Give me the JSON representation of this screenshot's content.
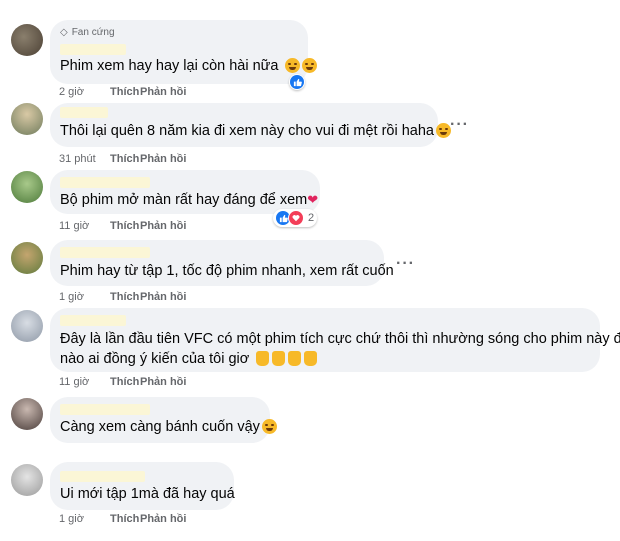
{
  "comments": [
    {
      "badge": "Fan cứng",
      "text": "Phim xem hay hay lại còn hài nữa",
      "time": "2 giờ",
      "like": "Thích",
      "reply": "Phản hồi"
    },
    {
      "text": "Thôi lại quên 8 năm kia đi xem này cho vui đi mệt rồi haha",
      "time": "31 phút",
      "like": "Thích",
      "reply": "Phản hồi"
    },
    {
      "text": "Bộ phim mở màn rất hay đáng để xem",
      "time": "11 giờ",
      "like": "Thích",
      "reply": "Phản hồi",
      "reaction_count": "2"
    },
    {
      "text": "Phim hay từ tập 1, tốc độ phim nhanh, xem rất cuốn",
      "time": "1 giờ",
      "like": "Thích",
      "reply": "Phản hồi"
    },
    {
      "text_line1": "Đây là lần đầu tiên VFC có một phim tích cực chứ thôi thì nhường sóng cho phim này đi",
      "text_line2": "nào ai đồng ý kiến của tôi giơ",
      "time": "11 giờ",
      "like": "Thích",
      "reply": "Phản hồi"
    },
    {
      "text": "Càng xem càng bánh cuốn vậy",
      "time": "",
      "like": "",
      "reply": ""
    },
    {
      "text": "Ui mới tập 1mà đã hay quá",
      "time": "1 giờ",
      "like": "Thích",
      "reply": "Phản hồi"
    }
  ],
  "colors": {
    "bubble": "#f0f2f5",
    "name_redaction": "#fbf6d6",
    "meta_text": "#65676b",
    "like_blue": "#1877f2",
    "love_red": "#f33e58"
  }
}
